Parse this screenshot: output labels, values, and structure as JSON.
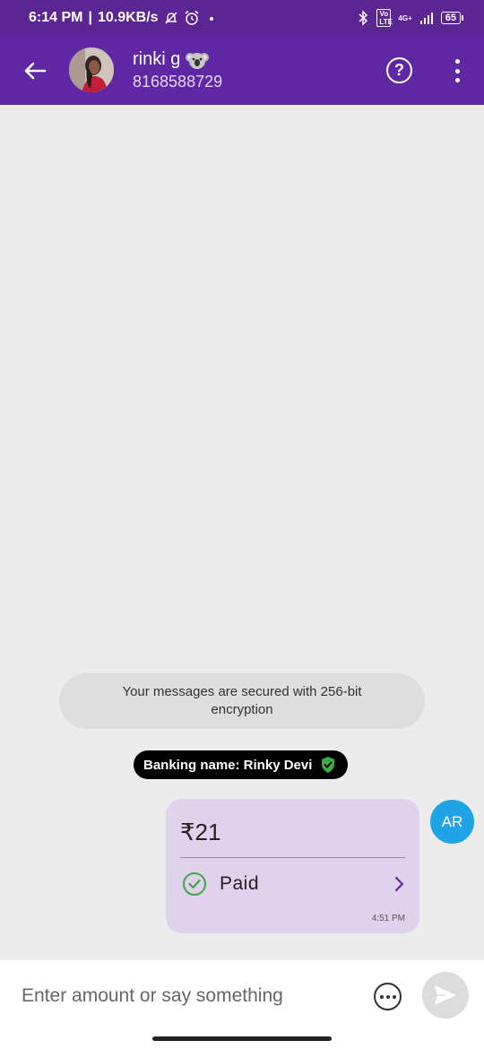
{
  "status_bar": {
    "time": "6:14 PM",
    "separator": "|",
    "speed": "10.9KB/s",
    "network_label": "4G+",
    "volte_label": "Vo LTE",
    "battery": "65"
  },
  "header": {
    "contact_name": "rinki g",
    "phone": "8168588729",
    "help_label": "?"
  },
  "chat": {
    "secure_note": "Your messages are secured with 256-bit encryption",
    "banking_name": "Banking name: Rinky  Devi",
    "payment": {
      "amount": "₹21",
      "status": "Paid",
      "time": "4:51 PM"
    },
    "sender_initials": "AR"
  },
  "input": {
    "placeholder": "Enter amount or say something"
  },
  "colors": {
    "header": "#5f27a3",
    "status_bar": "#5b2694",
    "bubble": "#e0d2ec",
    "paid_green": "#3daa4a",
    "ar_avatar": "#21a3e8"
  },
  "icons": [
    "back-arrow-icon",
    "help-icon",
    "more-vert-icon",
    "koala-emoji-icon",
    "verified-shield-icon",
    "check-circle-icon",
    "chevron-right-icon",
    "more-options-icon",
    "send-icon"
  ]
}
